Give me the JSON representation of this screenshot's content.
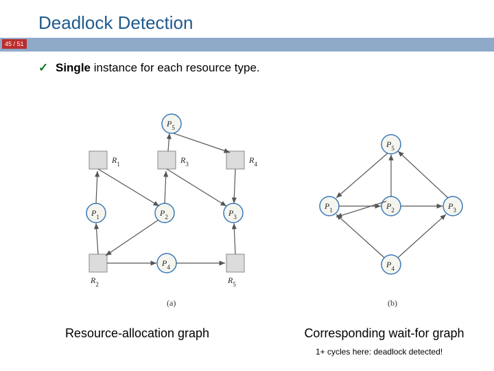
{
  "header": {
    "title": "Deadlock Detection",
    "page": "45 / 51"
  },
  "bullet": {
    "strong": "Single",
    "rest": " instance for each resource type."
  },
  "diagrams": {
    "a_label": "(a)",
    "b_label": "(b)",
    "rag": {
      "processes": [
        "P₁",
        "P₂",
        "P₃",
        "P₄",
        "P₅"
      ],
      "resources": [
        "R₁",
        "R₂",
        "R₃",
        "R₄",
        "R₅"
      ]
    },
    "wfg": {
      "processes": [
        "P₁",
        "P₂",
        "P₃",
        "P₄",
        "P₅"
      ]
    }
  },
  "captions": {
    "left": "Resource-allocation graph",
    "right": "Corresponding wait-for graph"
  },
  "footnote": "1+ cycles here: deadlock detected!"
}
